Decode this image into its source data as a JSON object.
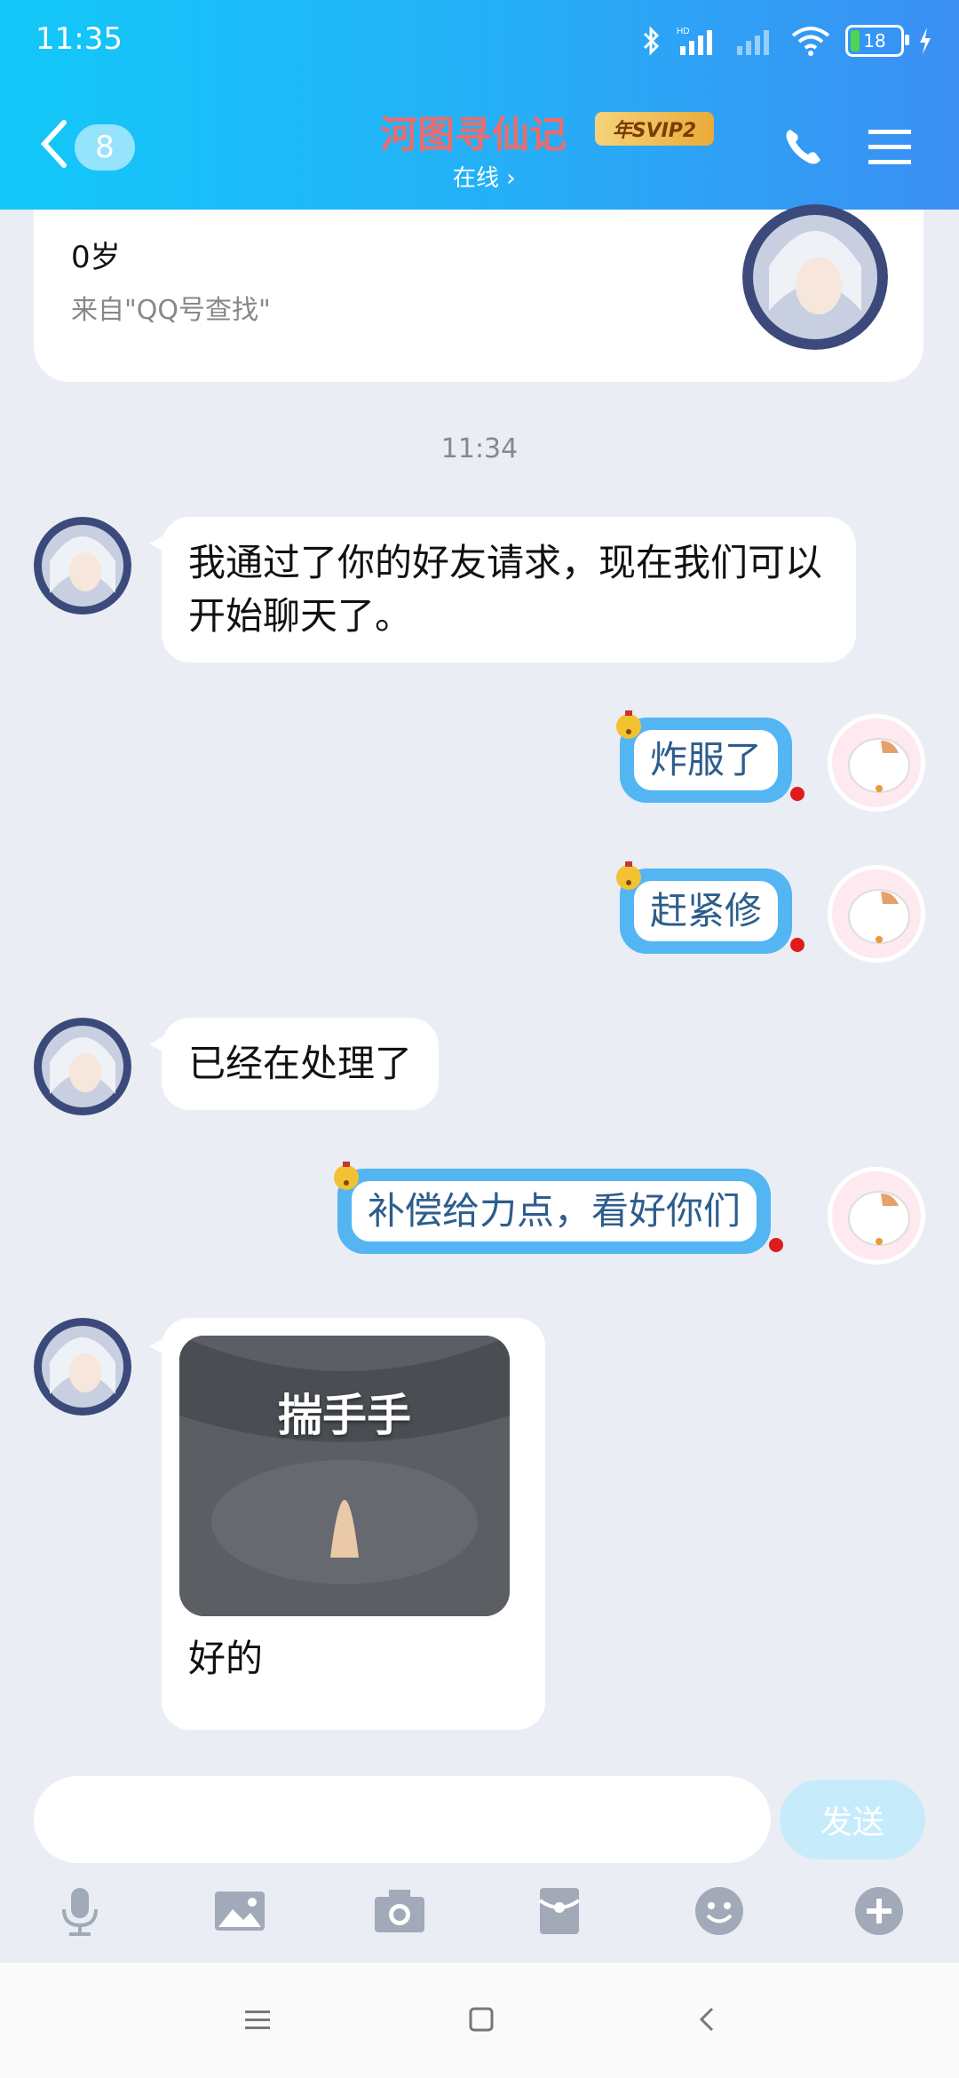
{
  "status_bar": {
    "time": "11:35",
    "battery": "18",
    "hd_label": "HD"
  },
  "header": {
    "unread_count": "8",
    "title": "河图寻仙记",
    "vip_badge": "年SVIP2",
    "status": "在线 ›"
  },
  "profile": {
    "age": "0岁",
    "source": "来自\"QQ号查找\""
  },
  "timestamp": "11:34",
  "messages": [
    {
      "from": "other",
      "text": "我通过了你的好友请求，现在我们可以开始聊天了。"
    },
    {
      "from": "me",
      "text": "炸服了"
    },
    {
      "from": "me",
      "text": "赶紧修"
    },
    {
      "from": "other",
      "text": "已经在处理了"
    },
    {
      "from": "me",
      "text": "补偿给力点，看好你们"
    },
    {
      "from": "other",
      "sticker_text": "揣手手",
      "text": "好的"
    }
  ],
  "input": {
    "placeholder": "",
    "send_label": "发送"
  },
  "toolbar": [
    "microphone-icon",
    "image-icon",
    "camera-icon",
    "red-packet-icon",
    "emoji-icon",
    "plus-icon"
  ],
  "colors": {
    "header_start": "#12c8f8",
    "header_end": "#3b8ff3",
    "bubble_out": "#53b6f3",
    "title": "#ec6c6c"
  }
}
